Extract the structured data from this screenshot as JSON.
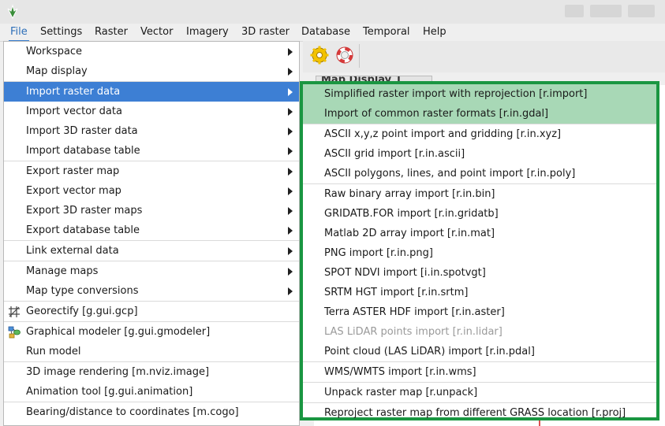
{
  "menubar": {
    "items": [
      {
        "label": "File",
        "active": true
      },
      {
        "label": "Settings"
      },
      {
        "label": "Raster"
      },
      {
        "label": "Vector"
      },
      {
        "label": "Imagery"
      },
      {
        "label": "3D raster"
      },
      {
        "label": "Database"
      },
      {
        "label": "Temporal"
      },
      {
        "label": "Help"
      }
    ]
  },
  "map_display": {
    "tab_label": "Map Display 1"
  },
  "file_menu": {
    "items": [
      {
        "label": "Workspace",
        "submenu": true
      },
      {
        "label": "Map display",
        "submenu": true
      },
      {
        "label": "Import raster data",
        "submenu": true,
        "highlighted": true
      },
      {
        "label": "Import vector data",
        "submenu": true
      },
      {
        "label": "Import 3D raster data",
        "submenu": true
      },
      {
        "label": "Import database table",
        "submenu": true
      },
      {
        "label": "Export raster map",
        "submenu": true
      },
      {
        "label": "Export vector map",
        "submenu": true
      },
      {
        "label": "Export 3D raster maps",
        "submenu": true
      },
      {
        "label": "Export database table",
        "submenu": true
      },
      {
        "label": "Link external data",
        "submenu": true
      },
      {
        "label": "Manage maps",
        "submenu": true
      },
      {
        "label": "Map type conversions",
        "submenu": true
      },
      {
        "label": "Georectify   [g.gui.gcp]",
        "icon": "georectify-icon"
      },
      {
        "label": "Graphical modeler   [g.gui.gmodeler]",
        "icon": "modeler-icon"
      },
      {
        "label": "Run model"
      },
      {
        "label": "3D image rendering   [m.nviz.image]"
      },
      {
        "label": "Animation tool   [g.gui.animation]"
      },
      {
        "label": "Bearing/distance to coordinates   [m.cogo]"
      }
    ]
  },
  "import_raster_submenu": {
    "items": [
      {
        "label": "Simplified raster import with reprojection   [r.import]",
        "highlighted": true
      },
      {
        "label": "Import of common raster formats   [r.in.gdal]",
        "highlighted": true
      },
      {
        "label": "ASCII x,y,z point import and gridding   [r.in.xyz]"
      },
      {
        "label": "ASCII grid import   [r.in.ascii]"
      },
      {
        "label": "ASCII polygons, lines, and point import   [r.in.poly]"
      },
      {
        "label": "Raw binary array import   [r.in.bin]"
      },
      {
        "label": "GRIDATB.FOR import   [r.in.gridatb]"
      },
      {
        "label": "Matlab 2D array import   [r.in.mat]"
      },
      {
        "label": "PNG import   [r.in.png]"
      },
      {
        "label": "SPOT NDVI import   [i.in.spotvgt]"
      },
      {
        "label": "SRTM HGT import   [r.in.srtm]"
      },
      {
        "label": "Terra ASTER HDF import   [r.in.aster]"
      },
      {
        "label": "LAS LiDAR points import   [r.in.lidar]",
        "disabled": true
      },
      {
        "label": "Point cloud (LAS LiDAR) import   [r.in.pdal]"
      },
      {
        "label": "WMS/WMTS import   [r.in.wms]"
      },
      {
        "label": "Unpack raster map   [r.unpack]"
      },
      {
        "label": "Reproject raster map from different GRASS location   [r.proj]"
      }
    ]
  },
  "colors": {
    "accent": "#3d7fd4",
    "highlight_green": "#a8d8b6",
    "border_green": "#1a9641"
  }
}
